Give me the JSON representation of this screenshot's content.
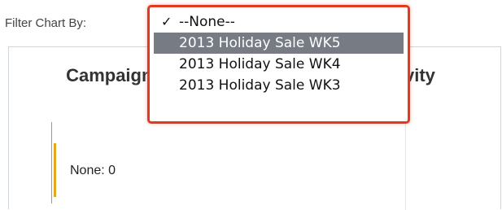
{
  "filter": {
    "label": "Filter Chart By:",
    "options": [
      {
        "label": "--None--",
        "selected": true,
        "highlighted": false
      },
      {
        "label": "2013 Holiday Sale WK5",
        "selected": false,
        "highlighted": true
      },
      {
        "label": "2013 Holiday Sale WK4",
        "selected": false,
        "highlighted": false
      },
      {
        "label": "2013 Holiday Sale WK3",
        "selected": false,
        "highlighted": false
      }
    ],
    "check_glyph": "✓",
    "highlight_color": "#e23a1e",
    "hover_color": "#767b84"
  },
  "chart": {
    "title_left": "Campaign",
    "title_right": "Activity",
    "value_label": "None: 0",
    "bar_color": "#e0a81a"
  }
}
